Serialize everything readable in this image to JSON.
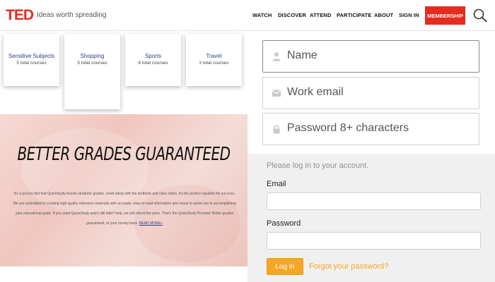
{
  "header": {
    "logo": "TED",
    "tagline": "Ideas worth spreading",
    "nav": [
      "WATCH",
      "DISCOVER",
      "ATTEND",
      "PARTICIPATE",
      "ABOUT",
      "SIGN IN"
    ],
    "membership": "MEMBERSHIP",
    "search_icon": "search-icon"
  },
  "categories": [
    {
      "title": "Sensitive Subjects",
      "count": "5 total courses"
    },
    {
      "title": "Shopping",
      "count": "5 total courses"
    },
    {
      "title": "Sports",
      "count": "6 total courses"
    },
    {
      "title": "Travel",
      "count": "3 total courses"
    }
  ],
  "banner": {
    "title": "BETTER GRADES GUARANTEED",
    "body": "It's a proven fact that QuickStudy boosts students' grades. Used along with the textbook and class notes, it's the perfect equation for success. We are committed to creating high quality reference materials with accurate, easy-to-read information and visual to assist you in accomplishing your educational goals. If you used QuickStudy and it still didn't help, we will refund the price. That's the QuickStudy Promise! Better grades guaranteed, or your money back.",
    "read_more": "READ MORE>"
  },
  "signup": {
    "name_placeholder": "Name",
    "email_placeholder": "Work email",
    "password_placeholder": "Password 8+ characters"
  },
  "login": {
    "hint": "Please log in to your account.",
    "email_label": "Email",
    "password_label": "Password",
    "button": "Log in",
    "forgot": "Forgot your password?"
  },
  "colors": {
    "brand_red": "#e62b1e",
    "login_orange": "#f6a623",
    "category_blue": "#2a3d8f"
  }
}
